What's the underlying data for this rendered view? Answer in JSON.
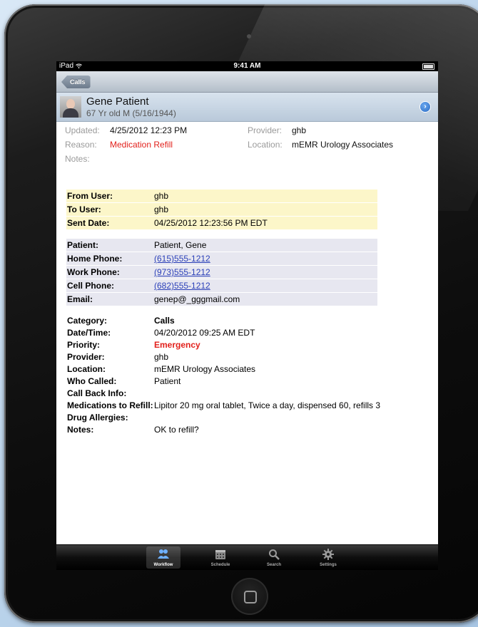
{
  "status_bar": {
    "device": "iPad",
    "time": "9:41 AM"
  },
  "nav": {
    "back_label": "Calls"
  },
  "patient": {
    "name": "Gene Patient",
    "subtitle": "67 Yr old   M   (5/16/1944)"
  },
  "summary": {
    "updated_label": "Updated:",
    "updated_value": "4/25/2012 12:23 PM",
    "reason_label": "Reason:",
    "reason_value": "Medication Refill",
    "notes_label": "Notes:",
    "provider_label": "Provider:",
    "provider_value": "ghb",
    "location_label": "Location:",
    "location_value": "mEMR Urology Associates"
  },
  "message": {
    "rows": [
      {
        "label": "From User:",
        "value": "ghb"
      },
      {
        "label": "To User:",
        "value": "ghb"
      },
      {
        "label": "Sent Date:",
        "value": "04/25/2012 12:23:56 PM EDT"
      }
    ]
  },
  "contact": {
    "rows": [
      {
        "label": "Patient:",
        "value": "Patient, Gene"
      },
      {
        "label": "Home Phone:",
        "value": "(615)555-1212"
      },
      {
        "label": "Work Phone:",
        "value": "(973)555-1212"
      },
      {
        "label": "Cell Phone:",
        "value": "(682)555-1212"
      },
      {
        "label": "Email:",
        "value": "genep@_gggmail.com"
      }
    ]
  },
  "details": {
    "rows": [
      {
        "label": "Category:",
        "value": "Calls"
      },
      {
        "label": "Date/Time:",
        "value": "04/20/2012 09:25 AM EDT"
      },
      {
        "label": "Priority:",
        "value": "Emergency"
      },
      {
        "label": "Provider:",
        "value": "ghb"
      },
      {
        "label": "Location:",
        "value": "mEMR Urology Associates"
      },
      {
        "label": "Who Called:",
        "value": "Patient"
      },
      {
        "label": "Call Back Info:",
        "value": ""
      },
      {
        "label": "Medications to Refill:",
        "value": "Lipitor 20 mg oral tablet, Twice a day, dispensed 60, refills 3"
      },
      {
        "label": "Drug Allergies:",
        "value": ""
      },
      {
        "label": "Notes:",
        "value": "OK to refill?"
      }
    ]
  },
  "tabs": [
    {
      "label": "Workflow",
      "icon": "people-icon",
      "active": true
    },
    {
      "label": "Schedule",
      "icon": "calendar-icon",
      "active": false
    },
    {
      "label": "Search",
      "icon": "search-icon",
      "active": false
    },
    {
      "label": "Settings",
      "icon": "gear-icon",
      "active": false
    }
  ],
  "colors": {
    "accent_red": "#e2211c",
    "link_blue": "#2a3fb8",
    "message_bg": "#fcf6c9",
    "contact_bg": "#e7e7f0"
  }
}
